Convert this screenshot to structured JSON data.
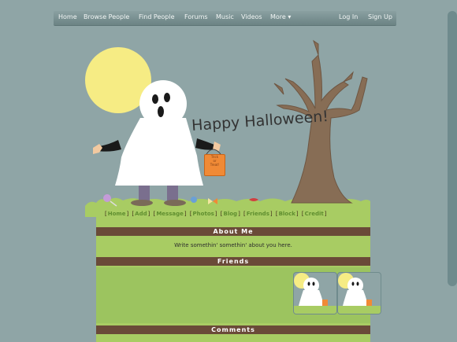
{
  "nav": {
    "left": [
      "Home",
      "Browse People",
      "Find People",
      "Forums",
      "Music",
      "Videos",
      "More ▾"
    ],
    "right": [
      "Log In",
      "Sign Up"
    ]
  },
  "banner": {
    "title": "Happy Halloween!",
    "sign_text": [
      "Trick",
      "or",
      "Treat!"
    ]
  },
  "links": [
    "Home",
    "Add",
    "Message",
    "Photos",
    "Blog",
    "Friends",
    "Block",
    "Credit"
  ],
  "sections": {
    "about": {
      "title": "About Me",
      "text": "Write somethin' somethin' about you here."
    },
    "friends": {
      "title": "Friends",
      "count": 2
    },
    "comments": {
      "title": "Comments"
    }
  },
  "colors": {
    "background": "#8fa5a6",
    "grass": "#a8cc63",
    "section_bar": "#6a4a38",
    "moon": "#f6ec84",
    "tree": "#876d55",
    "ghost": "#ffffff"
  },
  "icons": [
    "moon-icon",
    "ghost-icon",
    "tree-icon",
    "candy-icon"
  ]
}
